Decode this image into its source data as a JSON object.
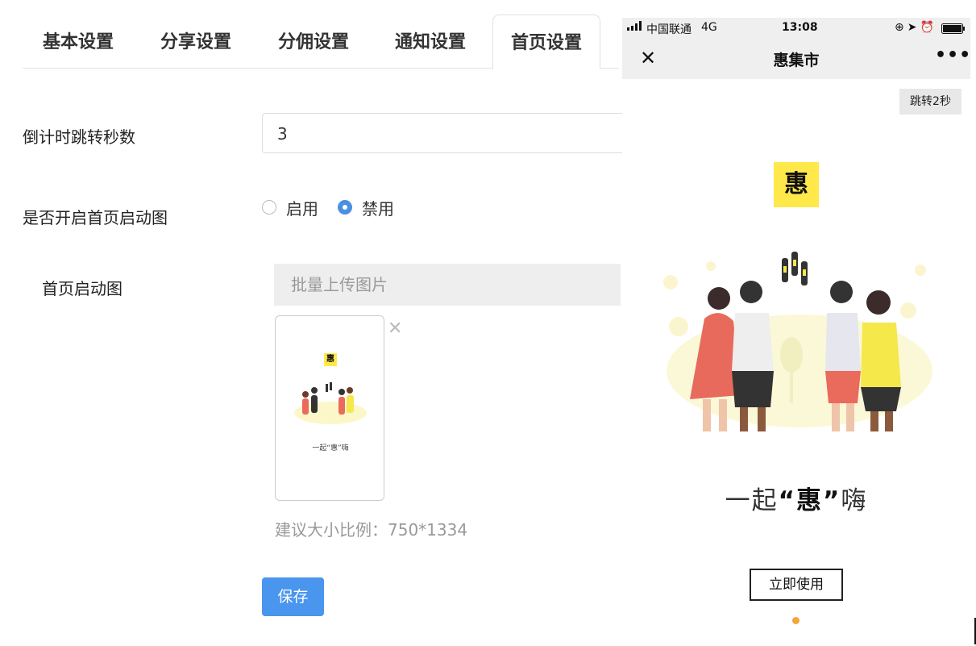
{
  "tabs": [
    "基本设置",
    "分享设置",
    "分佣设置",
    "通知设置",
    "首页设置"
  ],
  "active_tab": "首页设置",
  "form": {
    "countdown_label": "倒计时跳转秒数",
    "countdown_value": "3",
    "enable_label": "是否开启首页启动图",
    "radio_enable": "启用",
    "radio_disable": "禁用",
    "selected": "禁用",
    "image_label": "首页启动图",
    "upload_button": "批量上传图片",
    "hint": "建议大小比例：750*1334",
    "save_button": "保存"
  },
  "phone": {
    "carrier": "中国联通",
    "network": "4G",
    "time": "13:08",
    "title": "惠集市",
    "skip": "跳转2秒",
    "logo_char": "惠",
    "slogan_pre": "一起",
    "slogan_highlight": "“惠”",
    "slogan_post": "嗨",
    "use_button": "立即使用",
    "accent": "#ffe94a",
    "dot_color": "#f3a53b"
  },
  "thumb": {
    "logo_char": "惠",
    "slogan": "一起“惠”嗨"
  }
}
